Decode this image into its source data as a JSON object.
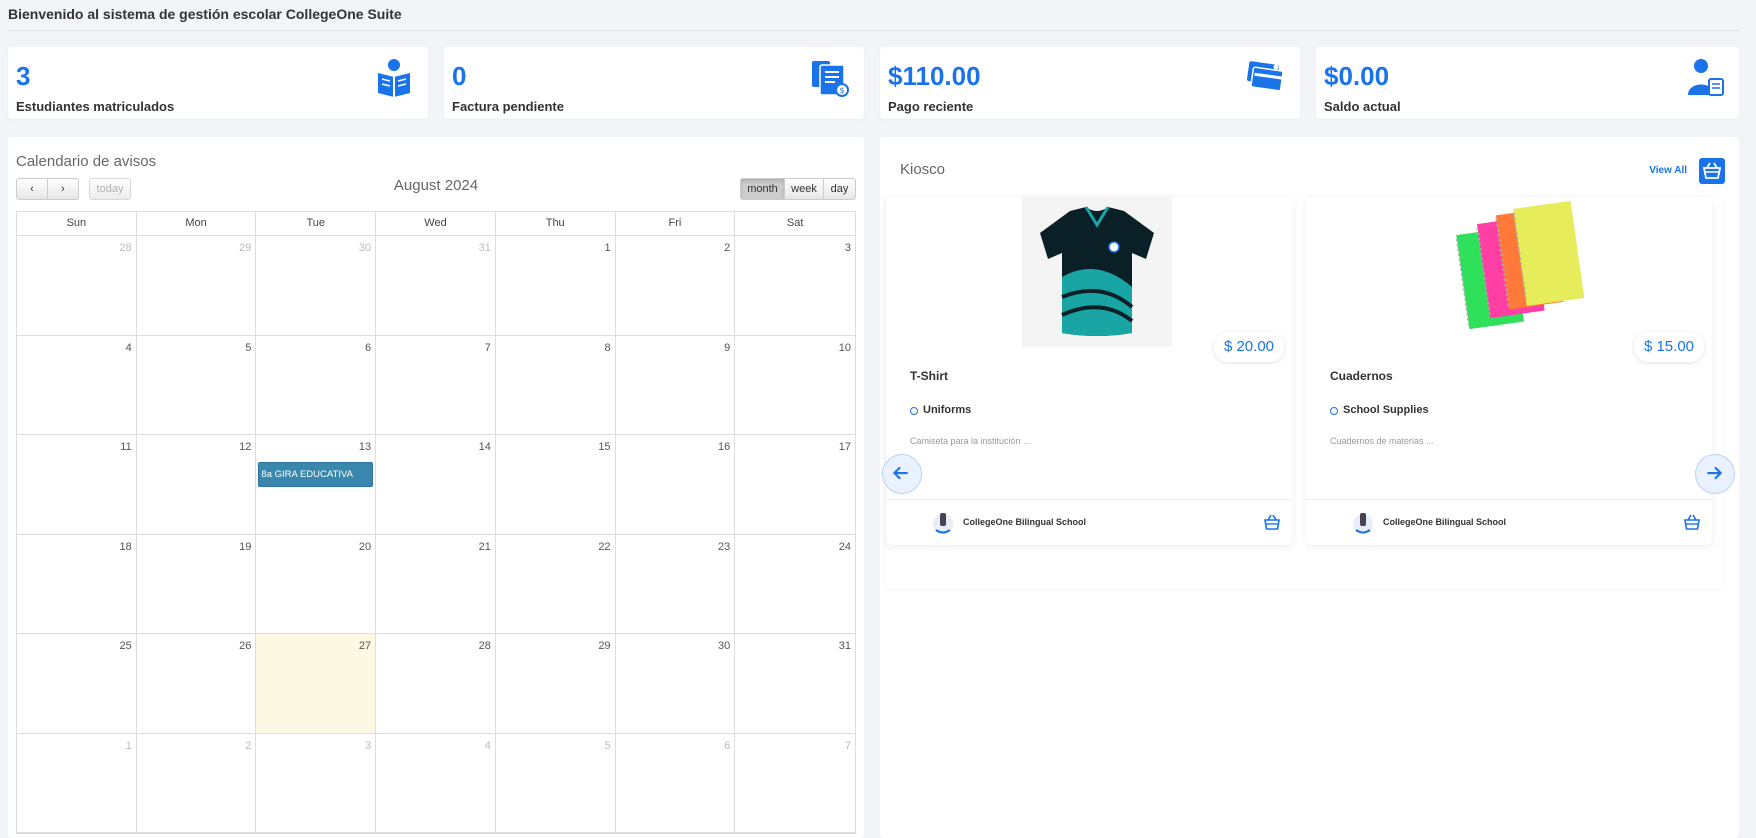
{
  "header": {
    "title": "Bienvenido al sistema de gestión escolar CollegeOne Suite"
  },
  "stats": [
    {
      "value": "3",
      "label": "Estudiantes matriculados",
      "icon": "student-reading-icon"
    },
    {
      "value": "0",
      "label": "Factura pendiente",
      "icon": "invoice-icon"
    },
    {
      "value": "$110.00",
      "label": "Pago reciente",
      "icon": "credit-card-icon"
    },
    {
      "value": "$0.00",
      "label": "Saldo actual",
      "icon": "user-balance-icon"
    }
  ],
  "calendar": {
    "title": "Calendario de avisos",
    "month_label": "August 2024",
    "today_label": "today",
    "view_month": "month",
    "view_week": "week",
    "view_day": "day",
    "weekdays": [
      "Sun",
      "Mon",
      "Tue",
      "Wed",
      "Thu",
      "Fri",
      "Sat"
    ],
    "weeks": [
      [
        "28",
        "29",
        "30",
        "31",
        "1",
        "2",
        "3"
      ],
      [
        "4",
        "5",
        "6",
        "7",
        "8",
        "9",
        "10"
      ],
      [
        "11",
        "12",
        "13",
        "14",
        "15",
        "16",
        "17"
      ],
      [
        "18",
        "19",
        "20",
        "21",
        "22",
        "23",
        "24"
      ],
      [
        "25",
        "26",
        "27",
        "28",
        "29",
        "30",
        "31"
      ],
      [
        "1",
        "2",
        "3",
        "4",
        "5",
        "6",
        "7"
      ]
    ],
    "event": {
      "label": "8a GIRA EDUCATIVA",
      "date": "13"
    },
    "today": "27"
  },
  "kiosk": {
    "title": "Kiosco",
    "view_all": "View All",
    "products": [
      {
        "name": "T-Shirt",
        "price": "$ 20.00",
        "category": "Uniforms",
        "description": "Camiseta para la institución ...",
        "school": "CollegeOne Bilingual School"
      },
      {
        "name": "Cuadernos",
        "price": "$ 15.00",
        "category": "School Supplies",
        "description": "Cuadernos de materias ...",
        "school": "CollegeOne Bilingual School"
      }
    ]
  },
  "colors": {
    "accent": "#1a73e8",
    "event": "#3a87ad",
    "today": "#fcf8e3"
  }
}
